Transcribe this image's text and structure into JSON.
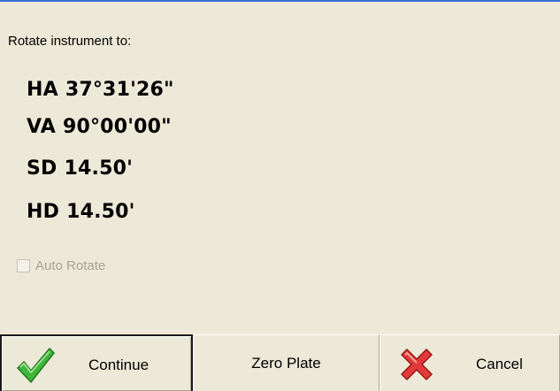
{
  "prompt": "Rotate instrument to:",
  "readouts": {
    "ha": {
      "label": "HA",
      "value": "37°31'26\""
    },
    "va": {
      "label": "VA",
      "value": "90°00'00\""
    },
    "sd": {
      "label": "SD",
      "value": "14.50'"
    },
    "hd": {
      "label": "HD",
      "value": "14.50'"
    }
  },
  "auto_rotate": {
    "label": "Auto Rotate",
    "checked": false,
    "enabled": false
  },
  "buttons": {
    "continue_label": "Continue",
    "zero_plate_label": "Zero Plate",
    "cancel_label": "Cancel"
  },
  "icons": {
    "continue": "green-checkmark-icon",
    "cancel": "red-x-icon"
  },
  "colors": {
    "background": "#ece9d8",
    "title_border": "#3a6fd3",
    "disabled_text": "#a6a393",
    "check_green": "#3fb53a",
    "cancel_red": "#e23a3a"
  }
}
